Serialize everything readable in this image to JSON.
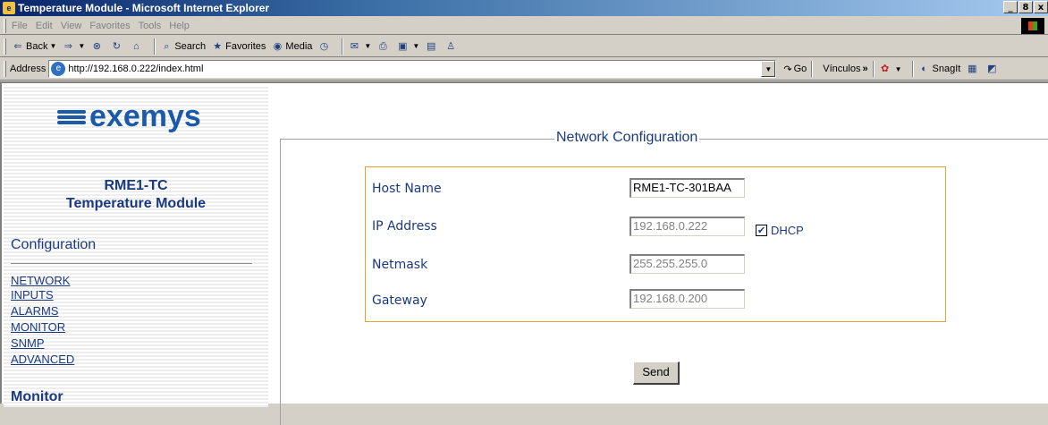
{
  "window": {
    "title": "Temperature Module - Microsoft Internet Explorer",
    "controls": [
      "_",
      "8",
      "x"
    ]
  },
  "menu": [
    "File",
    "Edit",
    "View",
    "Favorites",
    "Tools",
    "Help"
  ],
  "toolbar": {
    "back": "Back",
    "search": "Search",
    "favorites": "Favorites",
    "media": "Media"
  },
  "addressbar": {
    "label": "Address",
    "url": "http://192.168.0.222/index.html",
    "go": "Go",
    "links": "Vínculos",
    "snagit": "SnagIt"
  },
  "sidebar": {
    "logo_text": "exemys",
    "device_model": "RME1-TC",
    "device_name": "Temperature Module",
    "section_config": "Configuration",
    "nav": [
      "NETWORK",
      "INPUTS",
      "ALARMS",
      "MONITOR",
      "SNMP",
      "ADVANCED"
    ],
    "section_monitor": "Monitor"
  },
  "form": {
    "legend": "Network Configuration",
    "host_name_label": "Host Name",
    "host_name_value": "RME1-TC-301BAA",
    "ip_label": "IP Address",
    "ip_value": "192.168.0.222",
    "dhcp_label": "DHCP",
    "dhcp_checked": true,
    "netmask_label": "Netmask",
    "netmask_value": "255.255.255.0",
    "gateway_label": "Gateway",
    "gateway_value": "192.168.0.200",
    "send_label": "Send"
  },
  "colors": {
    "link": "#1a3a80",
    "logo": "#1a5aa6",
    "box_border": "#e8a030"
  }
}
